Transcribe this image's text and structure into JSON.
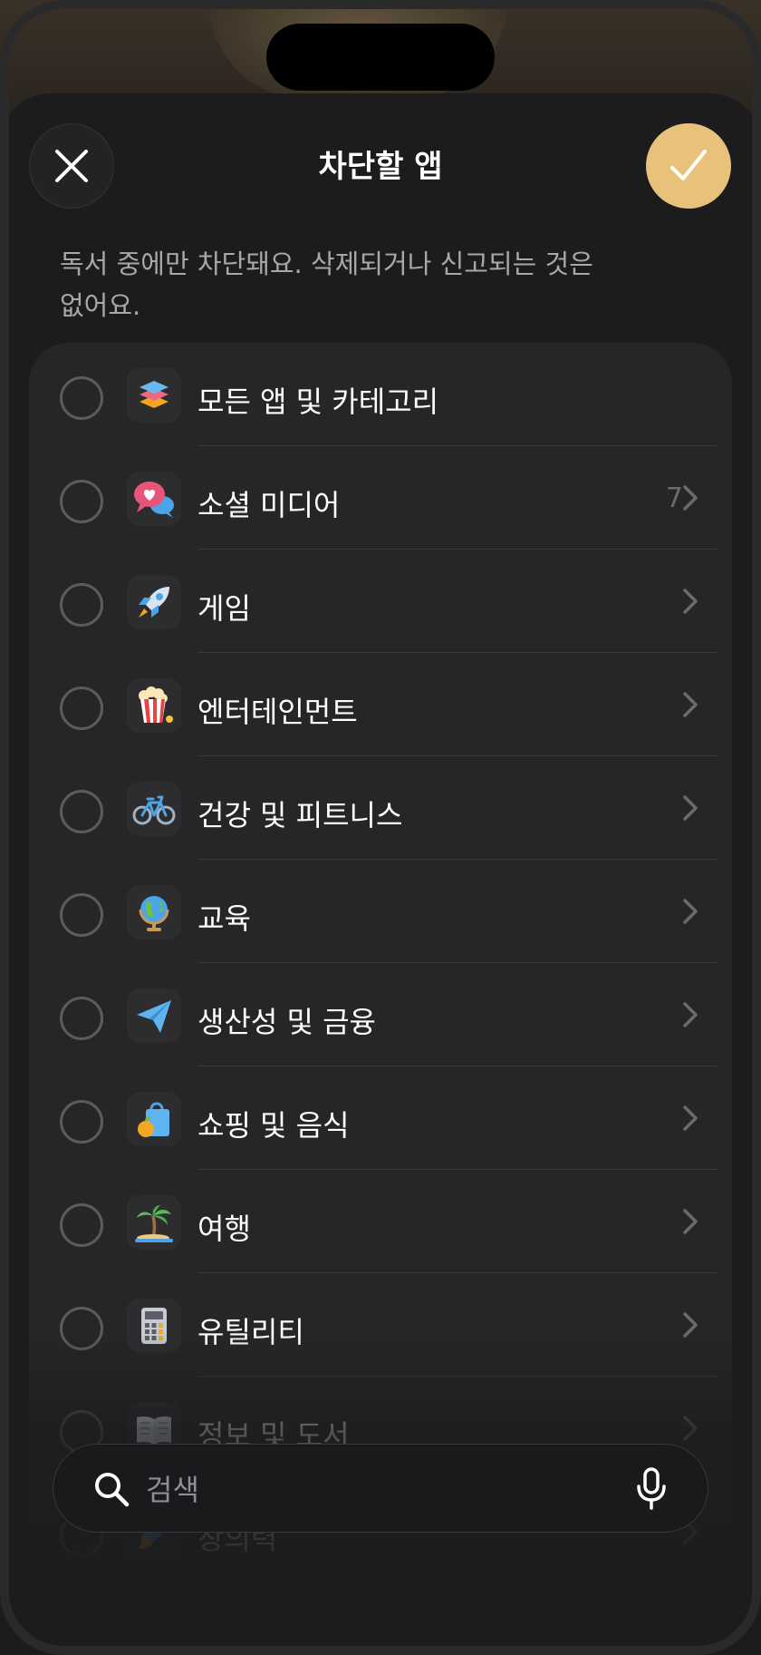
{
  "header": {
    "title": "차단할 앱",
    "description": "독서 중에만 차단돼요. 삭제되거나 신고되는 것은 없어요."
  },
  "categories": [
    {
      "label": "모든 앱 및 카테고리",
      "count": "",
      "icon": "stack-icon",
      "chevron": false
    },
    {
      "label": "소셜 미디어",
      "count": "7",
      "icon": "chat-heart-icon",
      "chevron": true
    },
    {
      "label": "게임",
      "count": "",
      "icon": "rocket-icon",
      "chevron": true
    },
    {
      "label": "엔터테인먼트",
      "count": "",
      "icon": "popcorn-icon",
      "chevron": true
    },
    {
      "label": "건강 및 피트니스",
      "count": "",
      "icon": "bicycle-icon",
      "chevron": true
    },
    {
      "label": "교육",
      "count": "",
      "icon": "globe-icon",
      "chevron": true
    },
    {
      "label": "생산성 및 금융",
      "count": "",
      "icon": "paper-plane-icon",
      "chevron": true
    },
    {
      "label": "쇼핑 및 음식",
      "count": "",
      "icon": "shopping-bag-icon",
      "chevron": true
    },
    {
      "label": "여행",
      "count": "",
      "icon": "palm-island-icon",
      "chevron": true
    },
    {
      "label": "유틸리티",
      "count": "",
      "icon": "calculator-icon",
      "chevron": true
    },
    {
      "label": "정보 및 도서",
      "count": "",
      "icon": "book-icon",
      "chevron": true
    },
    {
      "label": "창의력",
      "count": "",
      "icon": "paint-icon",
      "chevron": true
    }
  ],
  "search": {
    "placeholder": "검색"
  },
  "colors": {
    "accent": "#e8c17a",
    "sheet": "#1c1c1e",
    "list_bg": "#262628"
  }
}
